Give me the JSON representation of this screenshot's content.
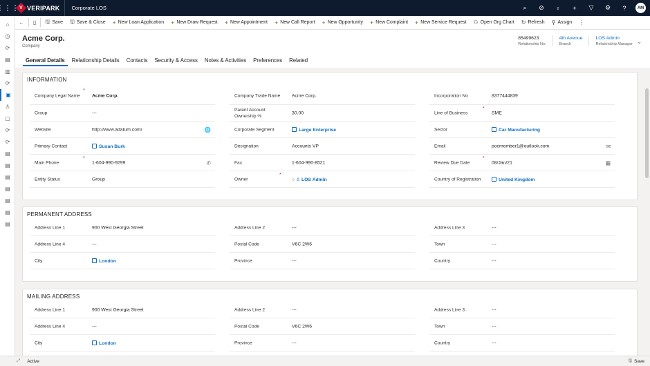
{
  "topbar": {
    "brand": "VERIPARK",
    "brand_mark": "V",
    "app_name": "Corporate LOS",
    "icons": [
      "search-icon",
      "target-icon",
      "lightbulb-icon",
      "plus-icon",
      "filter-icon",
      "gear-icon",
      "help-icon"
    ],
    "icon_glyphs": [
      "⌕",
      "⊘",
      "♀",
      "+",
      "▽",
      "⚙",
      "?"
    ],
    "avatar_initials": "AM"
  },
  "leftnav": {
    "icons": [
      "⌂",
      "◷",
      "⟳",
      "▤",
      "▥",
      "⟳",
      "▣",
      "♙",
      "▢",
      "⟳",
      "⟳",
      "▤",
      "▤",
      "▤",
      "▤",
      "▤",
      "▤",
      "▤"
    ]
  },
  "commandbar": {
    "back": "←",
    "record_icon": "▯",
    "items": [
      {
        "icon": "🖫",
        "label": "Save"
      },
      {
        "icon": "🖫",
        "label": "Save & Close"
      },
      {
        "icon": "+",
        "label": "New Loan Application"
      },
      {
        "icon": "+",
        "label": "New Draw Request"
      },
      {
        "icon": "+",
        "label": "New Appointment"
      },
      {
        "icon": "+",
        "label": "New Call Report"
      },
      {
        "icon": "+",
        "label": "New Opportunity"
      },
      {
        "icon": "+",
        "label": "New Complaint"
      },
      {
        "icon": "+",
        "label": "New Service Request"
      },
      {
        "icon": "⚇",
        "label": "Open Org Chart"
      },
      {
        "icon": "↻",
        "label": "Refresh"
      },
      {
        "icon": "⚲",
        "label": "Assign"
      }
    ],
    "more": "⋮"
  },
  "header": {
    "title": "Acme Corp.",
    "subtitle": "Company",
    "fields": [
      {
        "value": "85499623",
        "label": "Relationship No."
      },
      {
        "value": "4th Avenue",
        "label": "Branch"
      },
      {
        "value": "LOS Admin",
        "label": "Relationship Manager"
      }
    ],
    "chevron": "⌄"
  },
  "tabs": [
    "General Details",
    "Relationship Details",
    "Contacts",
    "Security & Access",
    "Notes & Activities",
    "Preferences",
    "Related"
  ],
  "information": {
    "title": "INFORMATION",
    "col1": [
      {
        "label": "Company Legal Name",
        "value": "Acme Corp.",
        "required": "*"
      },
      {
        "label": "Group",
        "value": "---"
      },
      {
        "label": "Website",
        "value": "http://www.adatum.com/",
        "icon": "🌐"
      },
      {
        "label": "Primary Contact",
        "value": "Susan Burk"
      },
      {
        "label": "Main Phone",
        "value": "1-604-990-9299",
        "required": "*",
        "icon": "✆"
      },
      {
        "label": "Entity Status",
        "value": "Group"
      }
    ],
    "col2": [
      {
        "label": "Company Trade Name",
        "value": "Acme Corp."
      },
      {
        "label": "Parent Account Ownership %",
        "value": "30.00"
      },
      {
        "label": "Corporate Segment",
        "value": "Large Enterprise"
      },
      {
        "label": "Designation",
        "value": "Accounts VP"
      },
      {
        "label": "Fax",
        "value": "1-604-990-8521"
      },
      {
        "label": "Owner",
        "value": "LOS Admin",
        "required": "*"
      }
    ],
    "col3": [
      {
        "label": "Incorporation No",
        "value": "8377444839"
      },
      {
        "label": "Line of Business",
        "value": "SME",
        "required": "*"
      },
      {
        "label": "Sector",
        "value": "Car Manufacturing"
      },
      {
        "label": "Email",
        "value": "pocmember1@outlook.com",
        "icon": "✉"
      },
      {
        "label": "Review Due Date",
        "value": "08/Jan/21",
        "required": "*",
        "icon": "▦"
      },
      {
        "label": "Country of Registration",
        "value": "United Kingdom"
      }
    ]
  },
  "permanent": {
    "title": "PERMANENT ADDRESS",
    "col1": [
      {
        "label": "Address Line 1",
        "value": "900 West Georgia Street"
      },
      {
        "label": "Address Line 4",
        "value": "---"
      },
      {
        "label": "City",
        "value": "London"
      }
    ],
    "col2": [
      {
        "label": "Address Line 2",
        "value": "---"
      },
      {
        "label": "Postal Code",
        "value": "V6C 2W6"
      },
      {
        "label": "Province",
        "value": "---"
      }
    ],
    "col3": [
      {
        "label": "Address Line 3",
        "value": "---"
      },
      {
        "label": "Town",
        "value": "---"
      },
      {
        "label": "Country",
        "value": "---"
      }
    ]
  },
  "mailing": {
    "title": "MAILING ADDRESS",
    "col1": [
      {
        "label": "Address Line 1",
        "value": "900 West Georgia Street"
      },
      {
        "label": "Address Line 4",
        "value": "---"
      },
      {
        "label": "City",
        "value": "London"
      }
    ],
    "col2": [
      {
        "label": "Address Line 2",
        "value": "---"
      },
      {
        "label": "Postal Code",
        "value": "V6C 2W6"
      },
      {
        "label": "Province",
        "value": "---"
      }
    ],
    "col3": [
      {
        "label": "Address Line 3",
        "value": "---"
      },
      {
        "label": "Town",
        "value": "---"
      },
      {
        "label": "Country",
        "value": "---"
      }
    ]
  },
  "statusbar": {
    "status": "Active",
    "save_label": "Save",
    "expand_icon": "⤢",
    "save_icon": "🖫"
  }
}
